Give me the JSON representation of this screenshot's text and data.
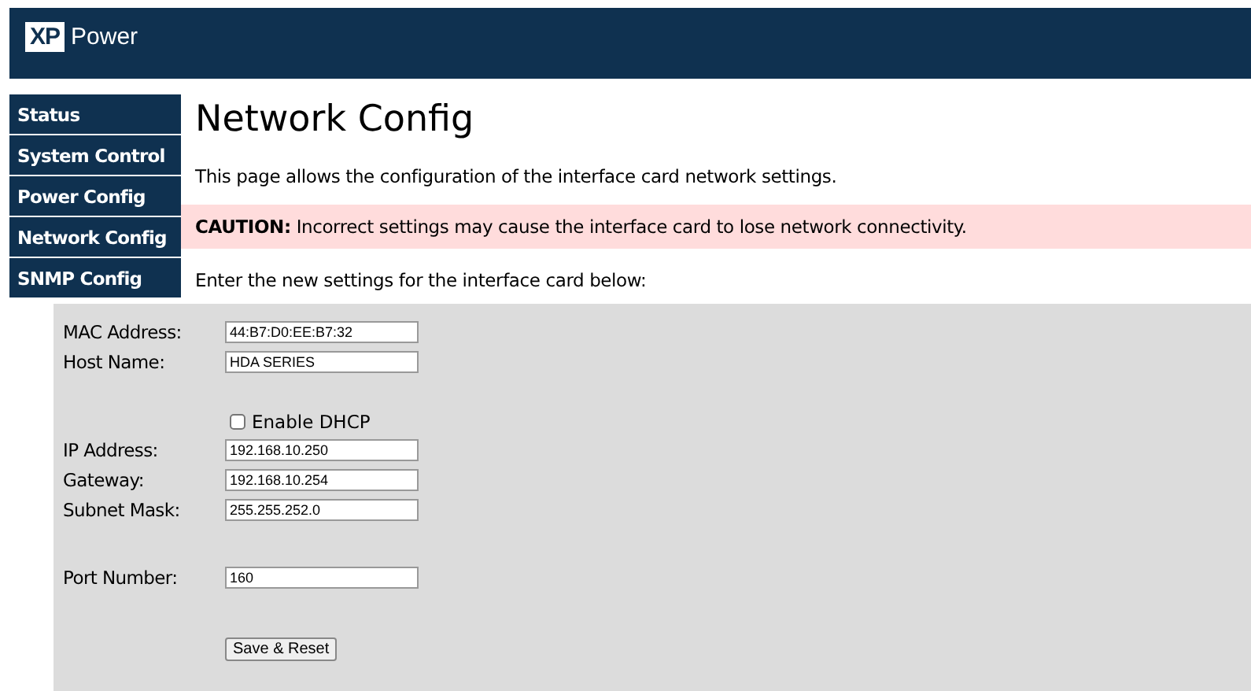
{
  "header": {
    "logo_mark": "XP",
    "logo_text": "Power"
  },
  "sidebar": {
    "items": [
      {
        "label": "Status"
      },
      {
        "label": "System Control"
      },
      {
        "label": "Power Config"
      },
      {
        "label": "Network Config"
      },
      {
        "label": "SNMP Config"
      }
    ]
  },
  "page": {
    "title": "Network Config",
    "intro": "This page allows the configuration of the interface card network settings.",
    "caution": "**CAUTION:** Incorrect settings may cause the interface card to lose network connectivity.",
    "instructions": "Enter the new settings for the interface card below:"
  },
  "form": {
    "sections": [
      {
        "fields": [
          {
            "label": "MAC Address:",
            "value": "44:B7:D0:EE:B7:32"
          },
          {
            "label": "Host Name:",
            "value": "HDA SERIES"
          }
        ]
      },
      {
        "checkbox": {
          "label": "Enable DHCP",
          "checked": false
        },
        "fields": [
          {
            "label": "IP Address:",
            "value": "192.168.10.250"
          },
          {
            "label": "Gateway:",
            "value": "192.168.10.254"
          },
          {
            "label": "Subnet Mask:",
            "value": "255.255.252.0"
          }
        ]
      },
      {
        "fields": [
          {
            "label": "Port Number:",
            "value": "160"
          }
        ]
      }
    ],
    "submit": "Save & Reset"
  }
}
